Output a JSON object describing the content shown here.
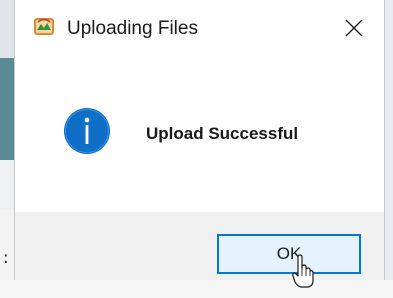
{
  "dialog": {
    "title": "Uploading Files",
    "app_icon": "app-icon",
    "close_icon": "close-icon",
    "message_icon": "info-icon",
    "message": "Upload Successful",
    "ok_label": "OK"
  },
  "colors": {
    "info_blue": "#0f6fc6",
    "focus_border": "#0078d7",
    "button_area": "#f0f0f0"
  },
  "cursor": "hand-pointer-icon"
}
